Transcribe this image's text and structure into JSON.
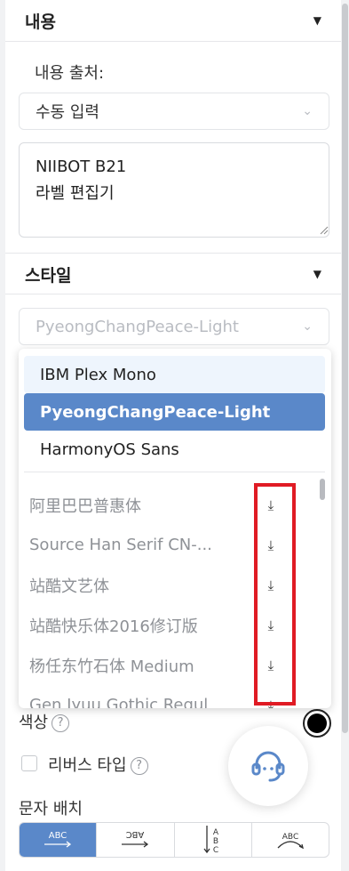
{
  "content_section": {
    "title": "내용",
    "source_label": "내용 출처:",
    "source_value": "수동 입력",
    "text_value": "NIIBOT B21\n라벨 편집기"
  },
  "style_section": {
    "title": "스타일",
    "font_value": "PyeongChangPeace-Light"
  },
  "font_dropdown": {
    "installed": [
      "IBM Plex Mono",
      "PyeongChangPeace-Light",
      "HarmonyOS Sans"
    ],
    "downloadable": [
      "阿里巴巴普惠体",
      "Source Han Serif CN-...",
      "站酷文艺体",
      "站酷快乐体2016修订版",
      "杨任东竹石体 Medium",
      "Gen Jyuu Gothic Regul"
    ],
    "download_icon": "download-icon"
  },
  "color": {
    "label": "색상",
    "value": "#000000"
  },
  "reverse_type": {
    "label": "리버스 타입",
    "checked": false
  },
  "text_layout": {
    "label": "문자 배치",
    "options": [
      "horizontal",
      "vertical-rotated",
      "vertical-stacked",
      "arc"
    ],
    "glyph_text": "ABC",
    "selected": "horizontal"
  },
  "help_glyph": "?",
  "colors": {
    "accent": "#5a88c9",
    "highlight": "#e01b24"
  }
}
